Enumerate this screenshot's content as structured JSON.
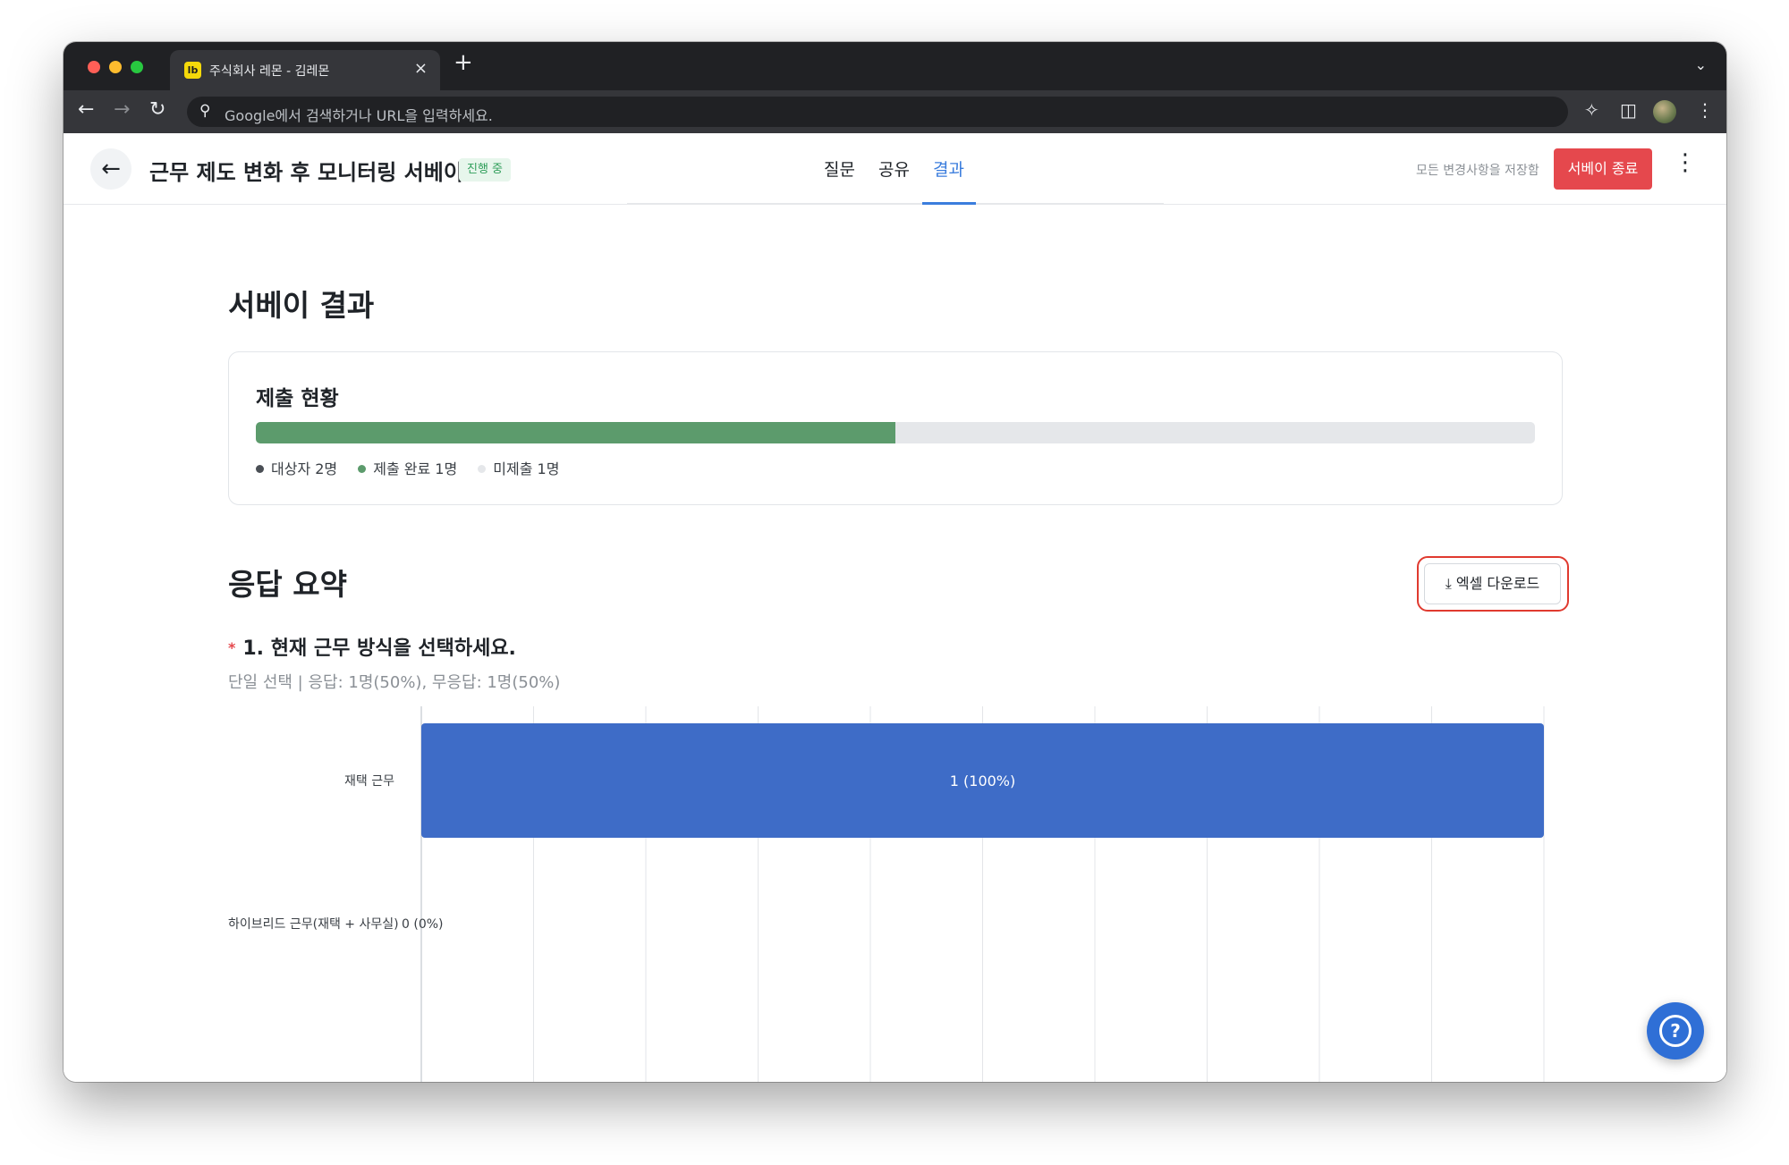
{
  "browser": {
    "tab_title": "주식회사 레몬 - 김레몬",
    "tab_favicon": "lb",
    "tab_close": "×",
    "new_tab": "+",
    "omnibox_placeholder": "Google에서 검색하거나 URL을 입력하세요."
  },
  "header": {
    "survey_title": "근무 제도 변화 후 모니터링 서베이",
    "status_badge": "진행 중",
    "tabs": [
      {
        "label": "질문",
        "active": false
      },
      {
        "label": "공유",
        "active": false
      },
      {
        "label": "결과",
        "active": true
      }
    ],
    "save_note": "모든 변경사항을 저장함",
    "end_button": "서베이 종료"
  },
  "results": {
    "title": "서베이 결과",
    "submission": {
      "title": "제출 현황",
      "progress": 0.5,
      "legend": [
        {
          "label": "대상자 2명",
          "color": "#4a4f55"
        },
        {
          "label": "제출 완료 1명",
          "color": "#5c9b6c"
        },
        {
          "label": "미제출 1명",
          "color": "#e5e7ea"
        }
      ]
    }
  },
  "summary": {
    "title": "응답 요약",
    "excel_button": "엑셀 다운로드",
    "question": {
      "required_mark": "*",
      "title": "1. 현재 근무 방식을 선택하세요.",
      "meta": "단일 선택 | 응답: 1명(50%), 무응답: 1명(50%)"
    }
  },
  "chart_data": {
    "type": "bar",
    "orientation": "horizontal",
    "categories": [
      "재택 근무",
      "하이브리드 근무(재택 + 사무실)"
    ],
    "values": [
      1,
      0
    ],
    "value_labels": [
      "1 (100%)",
      "0 (0%)"
    ],
    "xlim": [
      0,
      1
    ],
    "grid": true,
    "bar_color": "#3e6cc7"
  },
  "colors": {
    "accent": "#3b7ddd",
    "danger": "#e5484d",
    "success": "#5c9b6c"
  }
}
